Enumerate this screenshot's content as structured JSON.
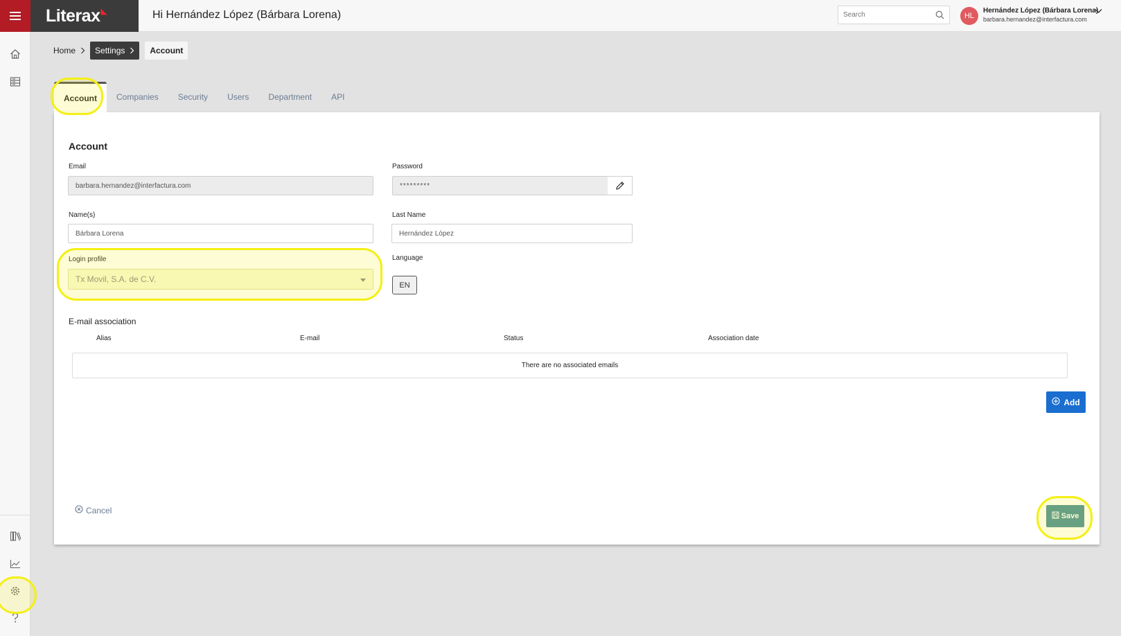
{
  "app": {
    "logo_text": "Literax",
    "greeting": "Hi Hernández López (Bárbara Lorena)"
  },
  "header": {
    "search_placeholder": "Search",
    "user": {
      "initials": "HL",
      "name": "Hernández López (Bárbara Lorena)",
      "email": "barbara.hernandez@interfactura.com"
    }
  },
  "breadcrumb": {
    "items": [
      "Home",
      "Settings",
      "Account"
    ]
  },
  "tabs": [
    "Account",
    "Companies",
    "Security",
    "Users",
    "Department",
    "API"
  ],
  "account": {
    "title": "Account",
    "email_label": "Email",
    "email_value": "barbara.hernandez@interfactura.com",
    "password_label": "Password",
    "password_value": "*********",
    "names_label": "Name(s)",
    "names_value": "Bárbara Lorena",
    "last_name_label": "Last Name",
    "last_name_value": "Hernández López",
    "login_profile_label": "Login profile",
    "login_profile_value": "Tx Movil, S.A. de C.V.",
    "language_label": "Language",
    "language_value": "EN"
  },
  "email_association": {
    "title": "E-mail association",
    "columns": [
      "Alias",
      "E-mail",
      "Status",
      "Association date"
    ],
    "empty_text": "There are no associated emails",
    "add_label": "Add"
  },
  "actions": {
    "cancel_label": "Cancel",
    "save_label": "Save"
  },
  "colors": {
    "brand_red": "#b31c25",
    "dark": "#3b3b3b",
    "primary_blue": "#1a6ed0",
    "save_teal": "#4a8f9a",
    "highlight": "#f4ef14"
  },
  "icons": {
    "menu": "hamburger-icon",
    "search": "search-icon",
    "user_menu": "chevron-down-icon",
    "home": "home-icon",
    "docs": "documents-icon",
    "library": "library-icon",
    "reports": "chart-icon",
    "settings": "gear-icon",
    "help": "help-icon",
    "edit": "pencil-icon",
    "add": "plus-circle-icon",
    "cancel": "close-circle-icon",
    "save": "floppy-icon"
  }
}
